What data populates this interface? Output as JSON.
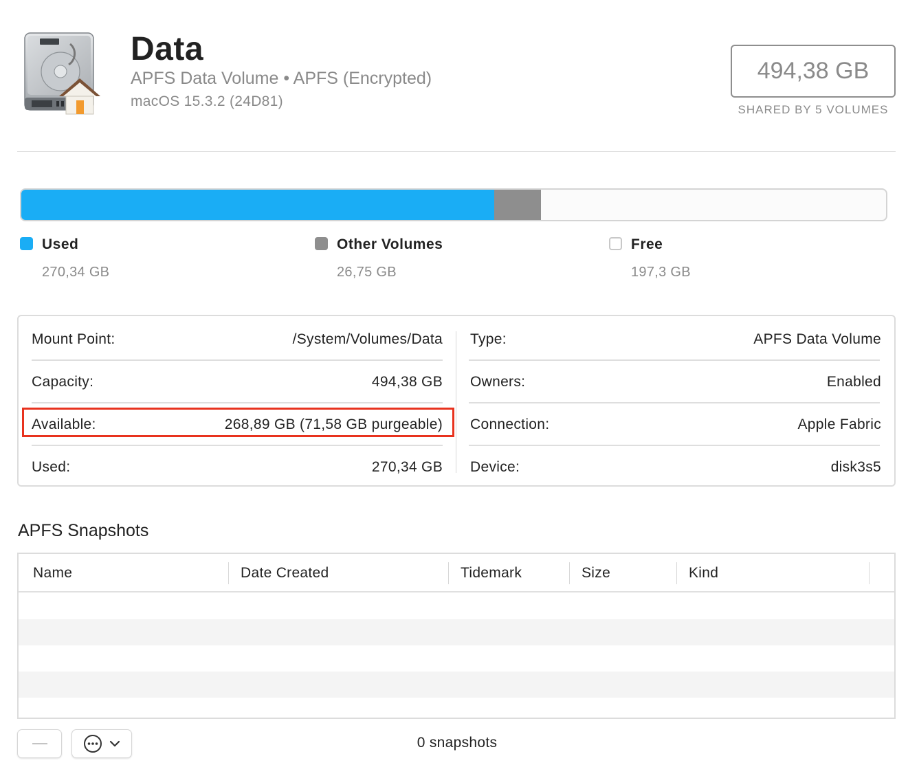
{
  "volume": {
    "name": "Data",
    "subtitle": "APFS Data Volume • APFS (Encrypted)",
    "os_version": "macOS 15.3.2 (24D81)",
    "capacity": "494,38 GB",
    "shared_label": "SHARED BY 5 VOLUMES",
    "icon": "internal-hard-drive-home-icon"
  },
  "usage": {
    "colors": {
      "used": "#1aadf5",
      "other": "#8e8e8e",
      "free": "#fbfbfb"
    },
    "fractions": {
      "used": 0.5468,
      "other": 0.0541,
      "free": 0.3991
    },
    "legend": [
      {
        "name": "Used",
        "value": "270,34 GB"
      },
      {
        "name": "Other Volumes",
        "value": "26,75 GB"
      },
      {
        "name": "Free",
        "value": "197,3 GB"
      }
    ]
  },
  "info": {
    "left": [
      {
        "label": "Mount Point:",
        "value": "/System/Volumes/Data"
      },
      {
        "label": "Capacity:",
        "value": "494,38 GB"
      },
      {
        "label": "Available:",
        "value": "268,89 GB (71,58 GB purgeable)"
      },
      {
        "label": "Used:",
        "value": "270,34 GB"
      }
    ],
    "right": [
      {
        "label": "Type:",
        "value": "APFS Data Volume"
      },
      {
        "label": "Owners:",
        "value": "Enabled"
      },
      {
        "label": "Connection:",
        "value": "Apple Fabric"
      },
      {
        "label": "Device:",
        "value": "disk3s5"
      }
    ],
    "highlight_color": "#e8321e"
  },
  "snapshots": {
    "title": "APFS Snapshots",
    "columns": [
      "Name",
      "Date Created",
      "Tidemark",
      "Size",
      "Kind"
    ],
    "rows": [],
    "count_label": "0 snapshots"
  },
  "footer": {
    "remove_icon": "minus-icon",
    "more_icon": "ellipsis-circle-icon",
    "chevron_icon": "chevron-down-icon"
  }
}
